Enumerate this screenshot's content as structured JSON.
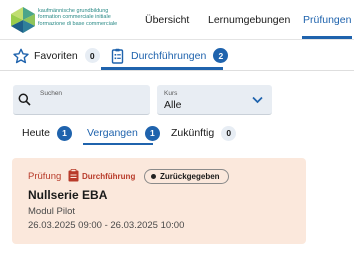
{
  "header": {
    "logo_lines": [
      "kaufmännische grundbildung",
      "formation commerciale initiale",
      "formazione di base commerciale"
    ],
    "nav": [
      {
        "label": "Übersicht"
      },
      {
        "label": "Lernumgebungen"
      },
      {
        "label": "Prüfungen"
      }
    ],
    "active_nav": "Prüfungen"
  },
  "subtabs": [
    {
      "label": "Favoriten",
      "count": "0",
      "icon": "star-icon"
    },
    {
      "label": "Durchführungen",
      "count": "2",
      "icon": "clipboard-list-icon"
    }
  ],
  "search": {
    "label": "Suchen",
    "value": ""
  },
  "course_select": {
    "label": "Kurs",
    "value": "Alle"
  },
  "filters": [
    {
      "label": "Heute",
      "count": "1"
    },
    {
      "label": "Vergangen",
      "count": "1"
    },
    {
      "label": "Zukünftig",
      "count": "0"
    }
  ],
  "active_filter": "Vergangen",
  "card": {
    "type": "Prüfung",
    "tag": "Durchführung",
    "status": "Zurückgegeben",
    "title": "Nullserie EBA",
    "subtitle": "Modul Pilot",
    "date_range": "26.03.2025 09:00 - 26.03.2025 10:00"
  },
  "colors": {
    "accent": "#1f63ad",
    "card_bg": "#fbe8dc",
    "exam_red": "#b83b2a",
    "logo_teal": "#2a8a86"
  }
}
